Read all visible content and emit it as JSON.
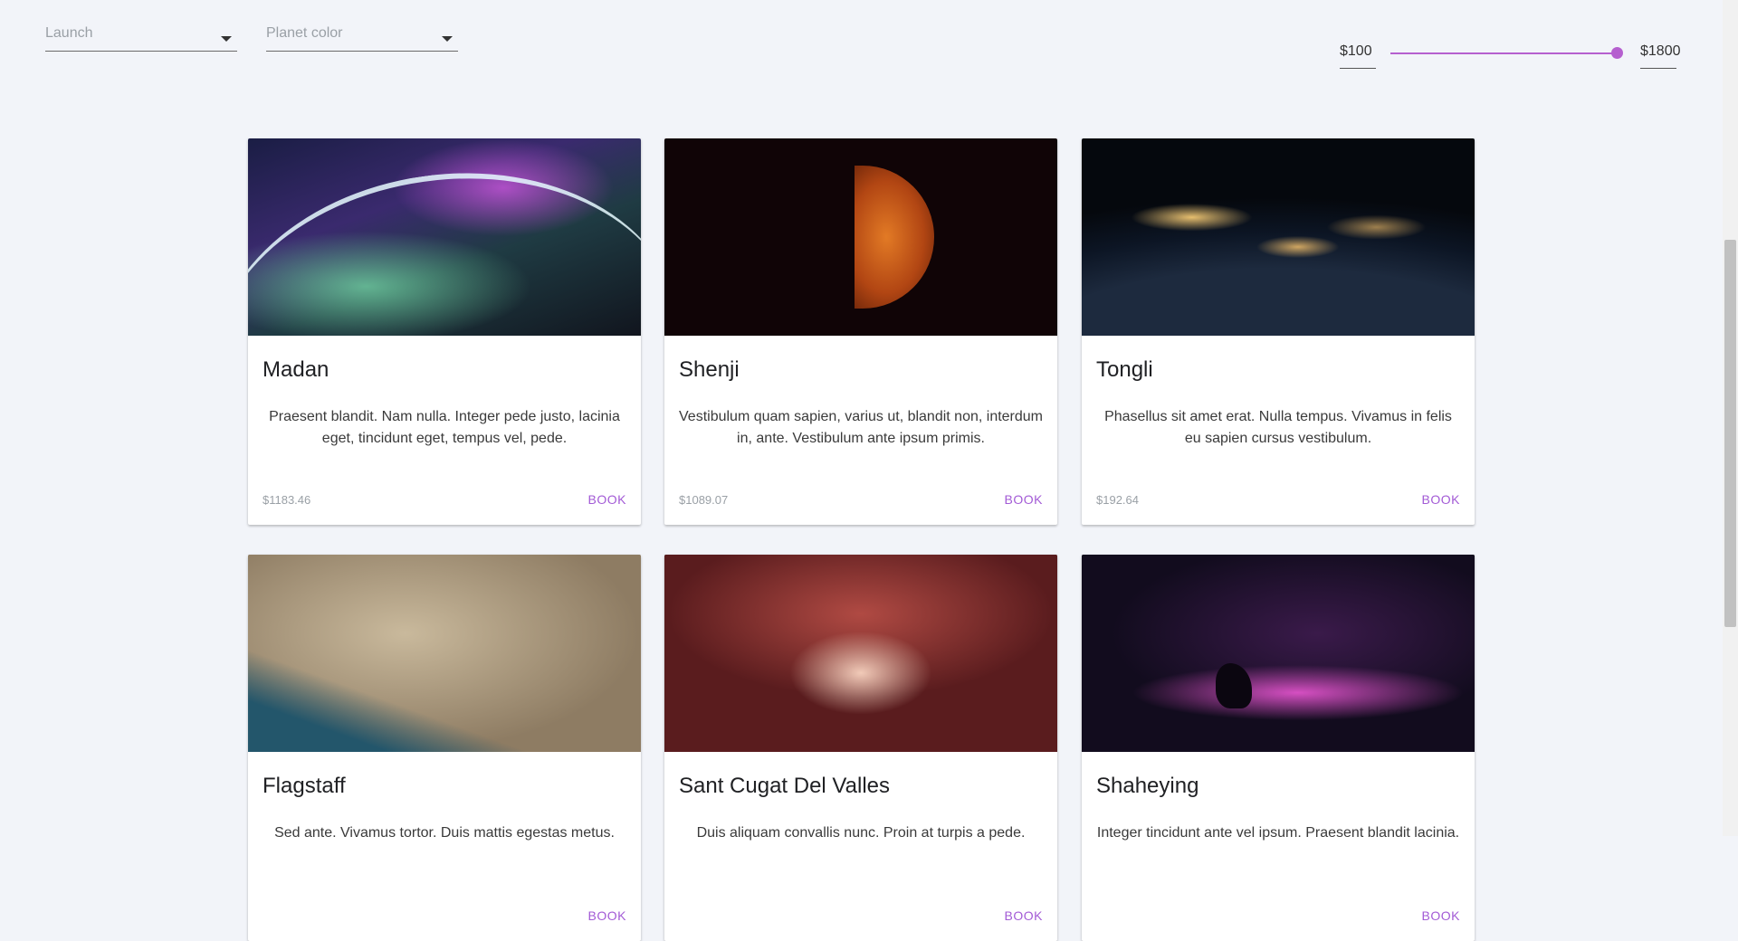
{
  "filters": {
    "launch_placeholder": "Launch",
    "planet_color_placeholder": "Planet color",
    "price_min": "$100",
    "price_max": "$1800",
    "slider_value_fraction": 1.0,
    "accent_color": "#b55fcf"
  },
  "cards": [
    {
      "title": "Madan",
      "description": "Praesent blandit. Nam nulla. Integer pede justo, lacinia eget, tincidunt eget, tempus vel, pede.",
      "price": "$1183.46",
      "action": "BOOK"
    },
    {
      "title": "Shenji",
      "description": "Vestibulum quam sapien, varius ut, blandit non, interdum in, ante. Vestibulum ante ipsum primis.",
      "price": "$1089.07",
      "action": "BOOK"
    },
    {
      "title": "Tongli",
      "description": "Phasellus sit amet erat. Nulla tempus. Vivamus in felis eu sapien cursus vestibulum.",
      "price": "$192.64",
      "action": "BOOK"
    },
    {
      "title": "Flagstaff",
      "description": "Sed ante. Vivamus tortor. Duis mattis egestas metus.",
      "price": "",
      "action": "BOOK"
    },
    {
      "title": "Sant Cugat Del Valles",
      "description": "Duis aliquam convallis nunc. Proin at turpis a pede.",
      "price": "",
      "action": "BOOK"
    },
    {
      "title": "Shaheying",
      "description": "Integer tincidunt ante vel ipsum. Praesent blandit lacinia.",
      "price": "",
      "action": "BOOK"
    }
  ]
}
